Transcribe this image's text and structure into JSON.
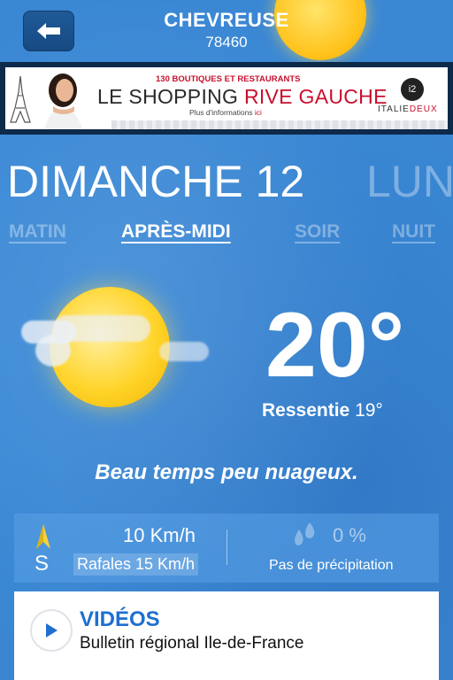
{
  "header": {
    "city": "CHEVREUSE",
    "zip": "78460"
  },
  "ad": {
    "top_line": "130 BOUTIQUES ET RESTAURANTS",
    "main_prefix": "LE SHOPPING ",
    "main_accent": "RIVE GAUCHE",
    "info_prefix": "Plus d'informations ",
    "info_link": "ici",
    "logo_mark": "i2",
    "brand_prefix": "ITALIE",
    "brand_accent": "DEUX"
  },
  "day": {
    "current": "DIMANCHE 12",
    "next": "LUN"
  },
  "periods": [
    {
      "label": "MATIN",
      "active": false
    },
    {
      "label": "APRÈS-MIDI",
      "active": true
    },
    {
      "label": "SOIR",
      "active": false
    },
    {
      "label": "NUIT",
      "active": false
    }
  ],
  "weather": {
    "temperature": "20°",
    "feels_label": "Ressentie",
    "feels_value": "19°",
    "description": "Beau temps peu nuageux.",
    "icon": "sun-with-clouds-icon"
  },
  "wind": {
    "direction": "S",
    "speed": "10 Km/h",
    "gusts": "Rafales 15 Km/h"
  },
  "precipitation": {
    "value": "0 %",
    "label": "Pas de précipitation"
  },
  "video": {
    "title": "VIDÉOS",
    "subtitle": "Bulletin régional Ile-de-France"
  },
  "colors": {
    "background": "#3d8bd6",
    "accent_red": "#c8102e",
    "video_title": "#1f6fd0",
    "sun": "#ffd42a"
  }
}
